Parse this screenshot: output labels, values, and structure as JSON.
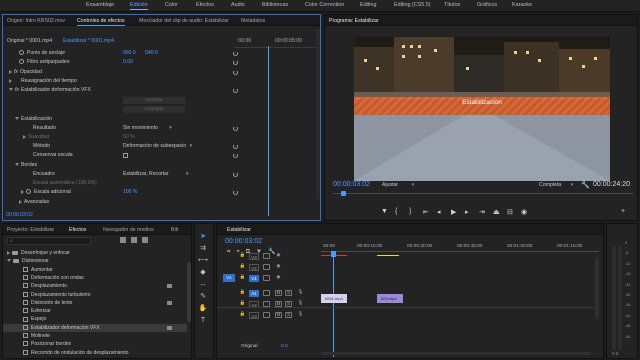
{
  "workspaces": {
    "items": [
      "Ensamblaje",
      "Edición",
      "Color",
      "Efectos",
      "Audio",
      "Bibliotecas",
      "Color Correction",
      "Editing",
      "Editing (CS5.5)",
      "Títulos",
      "Gráficos",
      "Karaoke"
    ],
    "active_index": 1
  },
  "source_panel": {
    "tabs": [
      "Origen: Intro KRS02.mov",
      "Controles de efectos",
      "Mezclador del clip de audio: Estabilizar",
      "Metadatos"
    ],
    "active_tab": 1,
    "clip_path": "Original * 0001.mp4",
    "clip_name": "Estabilizar * 0001.mp4",
    "ruler_start": ":00:00",
    "ruler_end": "00:00:05:00",
    "rows": [
      {
        "label": "Punto de anclaje",
        "v1": "960.0",
        "v2": "540.0"
      },
      {
        "label": "Filtro antiparpadeo",
        "v1": "0.00",
        "v2": ""
      }
    ],
    "opacity": "Opacidad",
    "remap": "Reasignación del tiempo",
    "effect": "Estabilizador deformación VFX",
    "analyze_btn": "Analizar",
    "cancel_btn": "Cancelar",
    "stab_section": "Estabilización",
    "result_label": "Resultado",
    "result_value": "Sin movimiento",
    "smooth_label": "Suavidad",
    "smooth_value": "50 %",
    "method_label": "Método",
    "method_value": "Deformación de subespacio",
    "keep_scale": "Conservar escala",
    "borders": "Bordes",
    "framing_label": "Encuadre",
    "framing_value": "Estabilizar, Recortar",
    "auto_scale": "Escala automática (100,0%)",
    "add_scale_label": "Escala adicional",
    "add_scale_value": "100 %",
    "advanced": "Avanzadas",
    "timecode": "00:00:03:02"
  },
  "program": {
    "tab": "Programa: Estabilizar",
    "overlay_text": "Estabilización",
    "timecode": "00:00:03:02",
    "fit": "Ajustar",
    "quality": "Completa",
    "duration": "00:00:24:20"
  },
  "project_panel": {
    "tabs": [
      "Proyecto: Estabilizar",
      "Efectos",
      "Navegador de medios",
      "Bib"
    ],
    "active_tab": 1,
    "items": [
      {
        "label": "Desenfoque y enfocar",
        "type": "folder"
      },
      {
        "label": "Distorsionar",
        "type": "folder-open"
      },
      {
        "label": "Aumentar",
        "type": "effect"
      },
      {
        "label": "Deformación con ondas",
        "type": "effect"
      },
      {
        "label": "Desplazamiento",
        "type": "effect"
      },
      {
        "label": "Desplazamiento turbulento",
        "type": "effect"
      },
      {
        "label": "Distorsión de lente",
        "type": "effect"
      },
      {
        "label": "Esferizar",
        "type": "effect"
      },
      {
        "label": "Espejo",
        "type": "effect"
      },
      {
        "label": "Estabilizador deformación VFX",
        "type": "effect"
      },
      {
        "label": "Molinete",
        "type": "effect"
      },
      {
        "label": "Posicionar bordes",
        "type": "effect"
      },
      {
        "label": "Recorrido de ondulación de desplazamiento",
        "type": "effect"
      }
    ],
    "selected_index": 9
  },
  "timeline": {
    "tab": "Estabilizar",
    "timecode": "00:00:03:02",
    "ruler": [
      "00:00",
      "00:00:15:00",
      "00:00:30:00",
      "00:00:45:00",
      "00:01:00:00",
      "00:01:15:00"
    ],
    "video_tracks": [
      "V3",
      "V2",
      "V1"
    ],
    "audio_tracks": [
      "A1",
      "A2",
      "A3"
    ],
    "master_label": "Original",
    "master_value": "0.0",
    "clip1": "0001.mp4",
    "clip2": "003.mp4"
  },
  "meter": {
    "scale": [
      "0",
      "-6",
      "-12",
      "-18",
      "-24",
      "-30",
      "-36",
      "-42",
      "-48",
      "-54"
    ],
    "footer": "S S"
  },
  "colors": {
    "accent": "#4a9bff",
    "clip_purple": "#9c88d6",
    "overlay_orange": "#e8703a"
  }
}
